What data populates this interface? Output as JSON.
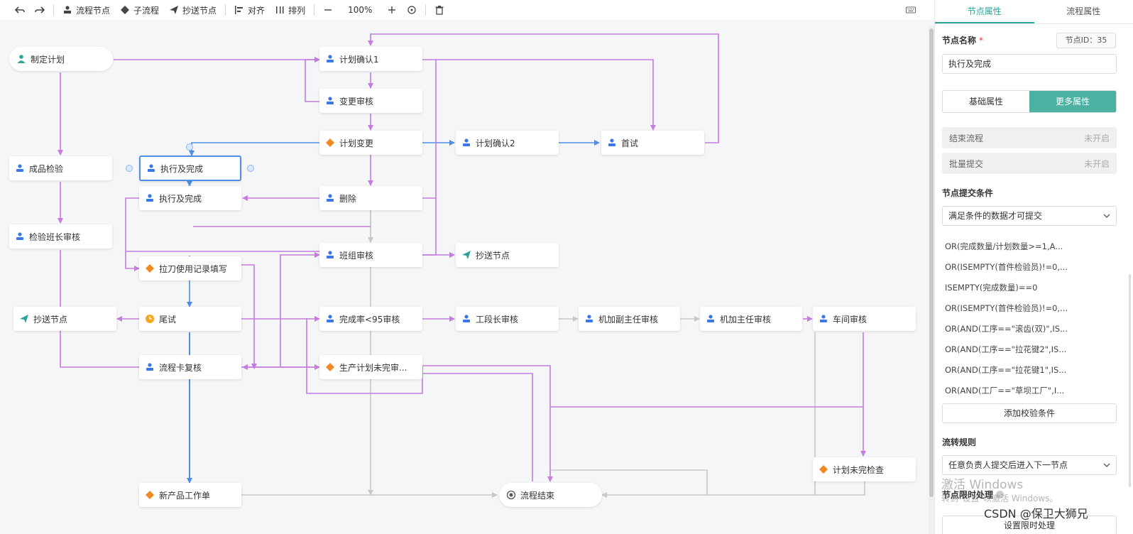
{
  "toolbar": {
    "flow_node": "流程节点",
    "sub_flow": "子流程",
    "cc_node": "抄送节点",
    "align": "对齐",
    "arrange": "排列",
    "zoom": "100%"
  },
  "colors": {
    "accent": "#4cb1a2",
    "edge_purple": "#c57bdf",
    "edge_blue": "#4f8ee8",
    "edge_gray": "#c8c8c8",
    "icon_blue": "#3b78e7",
    "icon_orange": "#f08a24",
    "icon_teal": "#2aa39a"
  },
  "nodes": [
    {
      "id": "n1",
      "label": "制定计划",
      "icon": "user-icon"
    },
    {
      "id": "n2",
      "label": "计划确认1",
      "icon": "stamp-icon"
    },
    {
      "id": "n3",
      "label": "变更审核",
      "icon": "stamp-icon"
    },
    {
      "id": "n4",
      "label": "计划变更",
      "icon": "diamond-icon"
    },
    {
      "id": "n5",
      "label": "计划确认2",
      "icon": "stamp-icon"
    },
    {
      "id": "n6",
      "label": "首试",
      "icon": "stamp-icon"
    },
    {
      "id": "n7",
      "label": "成品检验",
      "icon": "stamp-icon"
    },
    {
      "id": "n8",
      "label": "执行及完成",
      "icon": "stamp-icon"
    },
    {
      "id": "n9",
      "label": "执行及完成",
      "icon": "stamp-icon"
    },
    {
      "id": "n10",
      "label": "删除",
      "icon": "stamp-icon"
    },
    {
      "id": "n11",
      "label": "检验班长审核",
      "icon": "stamp-icon"
    },
    {
      "id": "n12",
      "label": "班组审核",
      "icon": "stamp-icon"
    },
    {
      "id": "n13",
      "label": "抄送节点",
      "icon": "send-icon"
    },
    {
      "id": "n14",
      "label": "拉刀使用记录填写",
      "icon": "diamond-icon"
    },
    {
      "id": "n15",
      "label": "抄送节点",
      "icon": "send-icon"
    },
    {
      "id": "n16",
      "label": "尾试",
      "icon": "clock-icon"
    },
    {
      "id": "n17",
      "label": "完成率<95审核",
      "icon": "stamp-icon"
    },
    {
      "id": "n18",
      "label": "工段长审核",
      "icon": "stamp-icon"
    },
    {
      "id": "n19",
      "label": "机加副主任审核",
      "icon": "stamp-icon"
    },
    {
      "id": "n20",
      "label": "机加主任审核",
      "icon": "stamp-icon"
    },
    {
      "id": "n21",
      "label": "车间审核",
      "icon": "stamp-icon"
    },
    {
      "id": "n22",
      "label": "流程卡复核",
      "icon": "stamp-icon"
    },
    {
      "id": "n23",
      "label": "生产计划未完审...",
      "icon": "diamond-icon"
    },
    {
      "id": "n24",
      "label": "计划未完检查",
      "icon": "diamond-icon"
    },
    {
      "id": "n25",
      "label": "新产品工作单",
      "icon": "diamond-icon"
    },
    {
      "id": "n26",
      "label": "流程结束",
      "icon": "end-icon"
    }
  ],
  "panel": {
    "tabs": [
      "节点属性",
      "流程属性"
    ],
    "node_name_label": "节点名称",
    "required_mark": "*",
    "node_id": "节点ID：35",
    "node_name_value": "执行及完成",
    "segments": [
      "基础属性",
      "更多属性"
    ],
    "end_flow_label": "结束流程",
    "end_flow_state": "未开启",
    "batch_submit_label": "批量提交",
    "batch_submit_state": "未开启",
    "submit_cond_label": "节点提交条件",
    "submit_cond_select": "满足条件的数据才可提交",
    "conditions": [
      "OR(完成数量/计划数量>=1,A...",
      "OR(ISEMPTY(首件检验员)!=0,...",
      "ISEMPTY(完成数量)==0",
      "OR(ISEMPTY(首件检验员)!=0,...",
      "OR(AND(工序==\"滚齿(双)\",IS...",
      "OR(AND(工序==\"拉花键2\",IS...",
      "OR(AND(工序==\"拉花键1\",IS...",
      "OR(AND(工厂==\"草坝工厂\",I..."
    ],
    "add_cond_button": "添加校验条件",
    "flow_rule_label": "流转规则",
    "flow_rule_select": "任意负责人提交后进入下一节点",
    "timeout_label": "节点限时处理",
    "timeout_button": "设置限时处理"
  },
  "watermark": {
    "line1": "激活 Windows",
    "line2": "转到\"设置\"以激活 Windows。",
    "credit": "CSDN @保卫大狮兄"
  }
}
